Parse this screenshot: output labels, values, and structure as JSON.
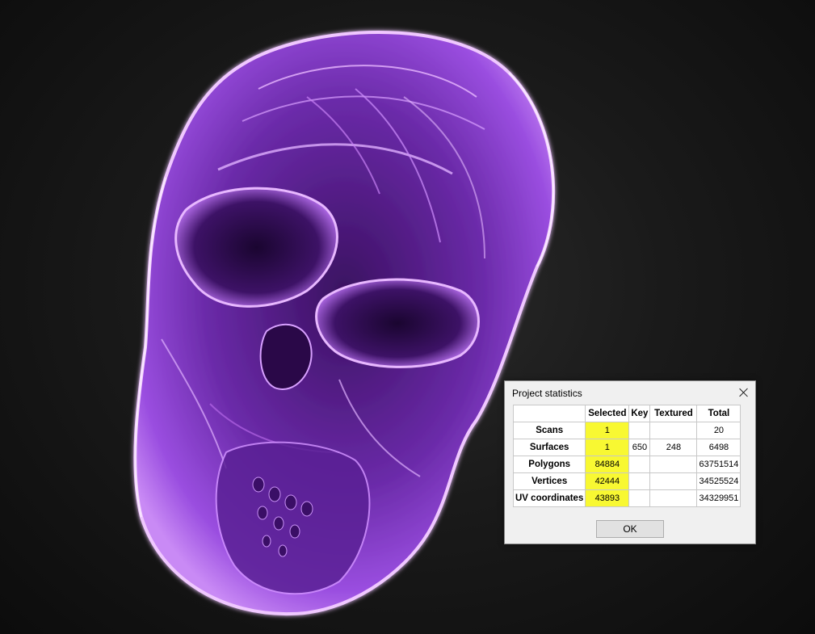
{
  "viewport": {
    "model_icon": "skull-3d-model",
    "glow_color": "#d98aff",
    "body_color": "#8a3fd0",
    "shadow_color": "#2b0a4a"
  },
  "dialog": {
    "title": "Project statistics",
    "close_icon": "close-icon",
    "ok_label": "OK",
    "highlight_color": "#f8f832",
    "columns": [
      "",
      "Selected",
      "Key",
      "Textured",
      "Total"
    ],
    "rows": [
      {
        "label": "Scans",
        "selected": "1",
        "key": "",
        "textured": "",
        "total": "20"
      },
      {
        "label": "Surfaces",
        "selected": "1",
        "key": "650",
        "textured": "248",
        "total": "6498"
      },
      {
        "label": "Polygons",
        "selected": "84884",
        "key": "",
        "textured": "",
        "total": "63751514"
      },
      {
        "label": "Vertices",
        "selected": "42444",
        "key": "",
        "textured": "",
        "total": "34525524"
      },
      {
        "label": "UV coordinates",
        "selected": "43893",
        "key": "",
        "textured": "",
        "total": "34329951"
      }
    ]
  }
}
